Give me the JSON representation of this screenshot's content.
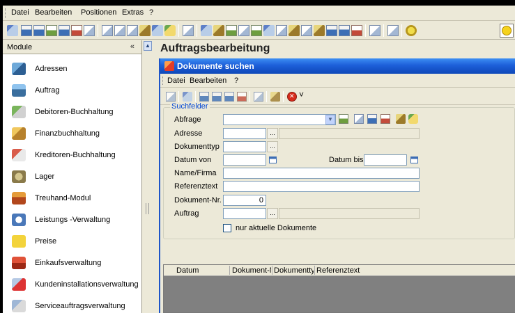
{
  "main_menu": [
    "Datei",
    "Bearbeiten",
    "Positionen",
    "Extras",
    "?"
  ],
  "modules": {
    "header": "Module",
    "collapse_glyph": "«",
    "items": [
      {
        "label": "Adressen",
        "icon": "address-book-icon"
      },
      {
        "label": "Auftrag",
        "icon": "order-icon"
      },
      {
        "label": "Debitoren-Buchhaltung",
        "icon": "debitors-icon"
      },
      {
        "label": "Finanzbuchhaltung",
        "icon": "finance-icon"
      },
      {
        "label": "Kreditoren-Buchhaltung",
        "icon": "creditors-icon"
      },
      {
        "label": "Lager",
        "icon": "warehouse-icon"
      },
      {
        "label": "Treuhand-Modul",
        "icon": "trust-icon"
      },
      {
        "label": "Leistungs -Verwaltung",
        "icon": "services-icon"
      },
      {
        "label": "Preise",
        "icon": "prices-icon"
      },
      {
        "label": "Einkaufsverwaltung",
        "icon": "purchasing-icon"
      },
      {
        "label": "Kundeninstallationsverwaltung",
        "icon": "customer-installation-icon"
      },
      {
        "label": "Serviceauftragsverwaltung",
        "icon": "service-order-icon"
      }
    ]
  },
  "page": {
    "title": "Auftragsbearbeitung"
  },
  "dialog": {
    "title": "Dokumente suchen",
    "menu": [
      "Datei",
      "Bearbeiten",
      "?"
    ],
    "fieldset_label": "Suchfelder",
    "fields": {
      "abfrage": "Abfrage",
      "adresse": "Adresse",
      "dokumenttyp": "Dokumenttyp",
      "datum_von": "Datum von",
      "datum_bis": "Datum bis",
      "name_firma": "Name/Firma",
      "referenztext": "Referenztext",
      "dokument_nr": "Dokument-Nr.",
      "dokument_nr_value": "0",
      "auftrag": "Auftrag"
    },
    "ellipsis": "...",
    "checkbox_label": "nur aktuelle Dokumente",
    "grid_columns": [
      "Datum",
      "Dokument-N",
      "Dokumenttyp",
      "Referenztext"
    ]
  },
  "colors": {
    "titlebar": "#1d5fd9",
    "legend": "#0046d5",
    "grid_bg": "#808080"
  }
}
